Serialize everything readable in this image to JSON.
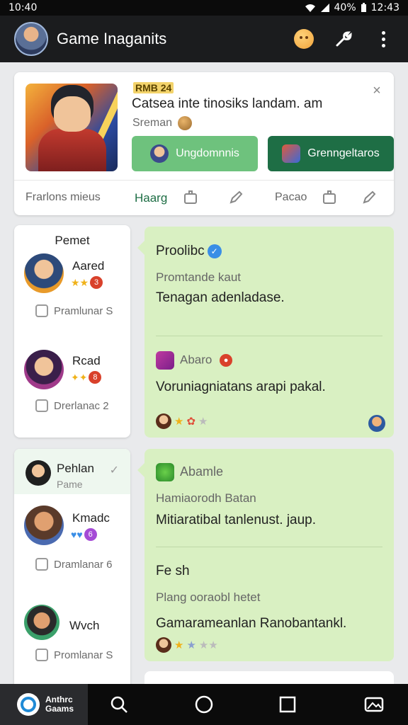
{
  "status_bar": {
    "time_left": "10:40",
    "battery": "40%",
    "time_right": "12:43"
  },
  "app_bar": {
    "title": "Game Inaganits",
    "avatar_icon": "profile-avatar",
    "actions": [
      "emoji-icon",
      "wrench-icon",
      "more-vert-icon"
    ]
  },
  "notification": {
    "tag": "RMB 24",
    "title": "Catsea inte tinosiks landam. am",
    "subtitle": "Sreman",
    "close_label": "×",
    "primary_button": "Ungdomnnis",
    "secondary_button": "Grenngeltaros",
    "tabs": {
      "first": "Frarlons mieus",
      "active": "Haarg",
      "third": "Pacao"
    }
  },
  "section1": {
    "title": "Pemet",
    "people": [
      {
        "name": "Aared",
        "sub": "Pramlunar S"
      },
      {
        "name": "Rcad",
        "sub": "Drerlanac 2"
      }
    ],
    "post": {
      "title": "Proolibc",
      "subtitle": "Promtande kaut",
      "body": "Tenagan adenladase.",
      "author": "Abaro",
      "message": "Voruniagniatans arapi pakal."
    }
  },
  "section2": {
    "selected": {
      "name": "Pehlan",
      "sub": "Pame"
    },
    "people": [
      {
        "name": "Kmadc",
        "sub": "Dramlanar 6"
      },
      {
        "name": "Wvch",
        "sub": "Promlanar S"
      }
    ],
    "post": {
      "author": "Abamle",
      "subtitle": "Hamiaorodh Batan",
      "body": "Mitiaratibal tanlenust. jaup.",
      "title2": "Fe sh",
      "subtitle2": "Plang ooraobl hetet",
      "body2": "Gamarameanlan Ranobantankl."
    }
  },
  "nav": {
    "home_label_1": "Anthrc",
    "home_label_2": "Gaams"
  },
  "colors": {
    "accent_green": "#1e6e45",
    "button_green": "#6ec27d",
    "post_bg": "#d9f0c2",
    "appbar": "#1b1c1e"
  }
}
